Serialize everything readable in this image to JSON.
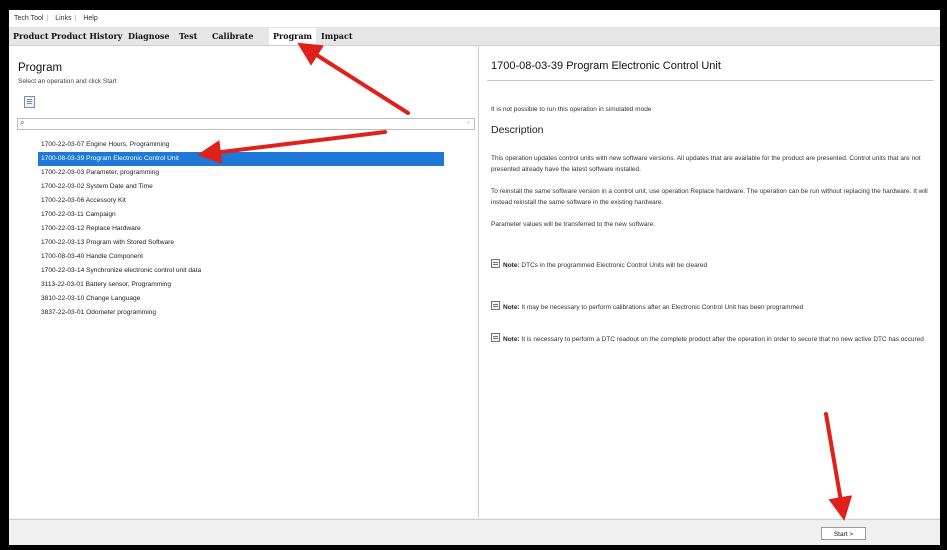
{
  "menubar": {
    "items": [
      "Tech Tool",
      "Links",
      "Help"
    ]
  },
  "tabs": [
    {
      "label": "Product"
    },
    {
      "label": "Product History"
    },
    {
      "label": "Diagnose"
    },
    {
      "label": "Test"
    },
    {
      "label": "Calibrate"
    },
    {
      "label": "Program",
      "active": true
    },
    {
      "label": "Impact"
    }
  ],
  "left": {
    "title": "Program",
    "hint": "Select an operation and click Start",
    "search_value": "",
    "operations": [
      "1700-22-03-07  Engine Hours, Programming",
      "1700-08-03-39 Program Electronic Control Unit",
      "1700-22-03-03 Parameter, programming",
      "1700-22-03-02 System Date and Time",
      "1700-22-03-06 Accessory Kit",
      "1700-22-03-11 Campaign",
      "1700-22-03-12 Replace Hardware",
      "1700-22-03-13 Program with Stored Software",
      "1700-08-03-40 Handle Component",
      "1700-22-03-14 Synchronize electronic control unit data",
      "3113-22-03-01 Battery sensor, Programming",
      "3810-22-03-10 Change Language",
      "3837-22-03-01 Odometer programming"
    ],
    "selected_index": 1
  },
  "right": {
    "title": "1700-08-03-39 Program Electronic Control Unit",
    "sim_notice": "It is not possible to run this operation in simulated mode",
    "description_heading": "Description",
    "para1": "This operation updates control units with new software versions. All updates that are available for the product are presented. Control units that are not presented already have the latest software installed.",
    "para2": "To reinstall the same software version in a control unit, use operation Replace hardware. The operation can be run without replacing the hardware. It will instead reinstall the same software in the existing hardware.",
    "para3": "Parameter values will be transferred to the new software.",
    "note_label": "Note:",
    "note1": "DTCs in the programmed Electronic Control Units will be cleared",
    "note2": "It may be necessary to perform calibrations after an Electronic Control Unit has been programmed",
    "note3": "It is necessary to perform a DTC readout on the complete product after the operation in order to secure that no new active DTC has occured"
  },
  "footer": {
    "start_label": "Start >"
  },
  "colors": {
    "selection": "#1e78d7",
    "annotation_arrow": "#e0201a"
  },
  "icons": [
    "document-icon",
    "search-icon",
    "chevron-down-icon",
    "note-icon",
    "arrow-annotation"
  ]
}
